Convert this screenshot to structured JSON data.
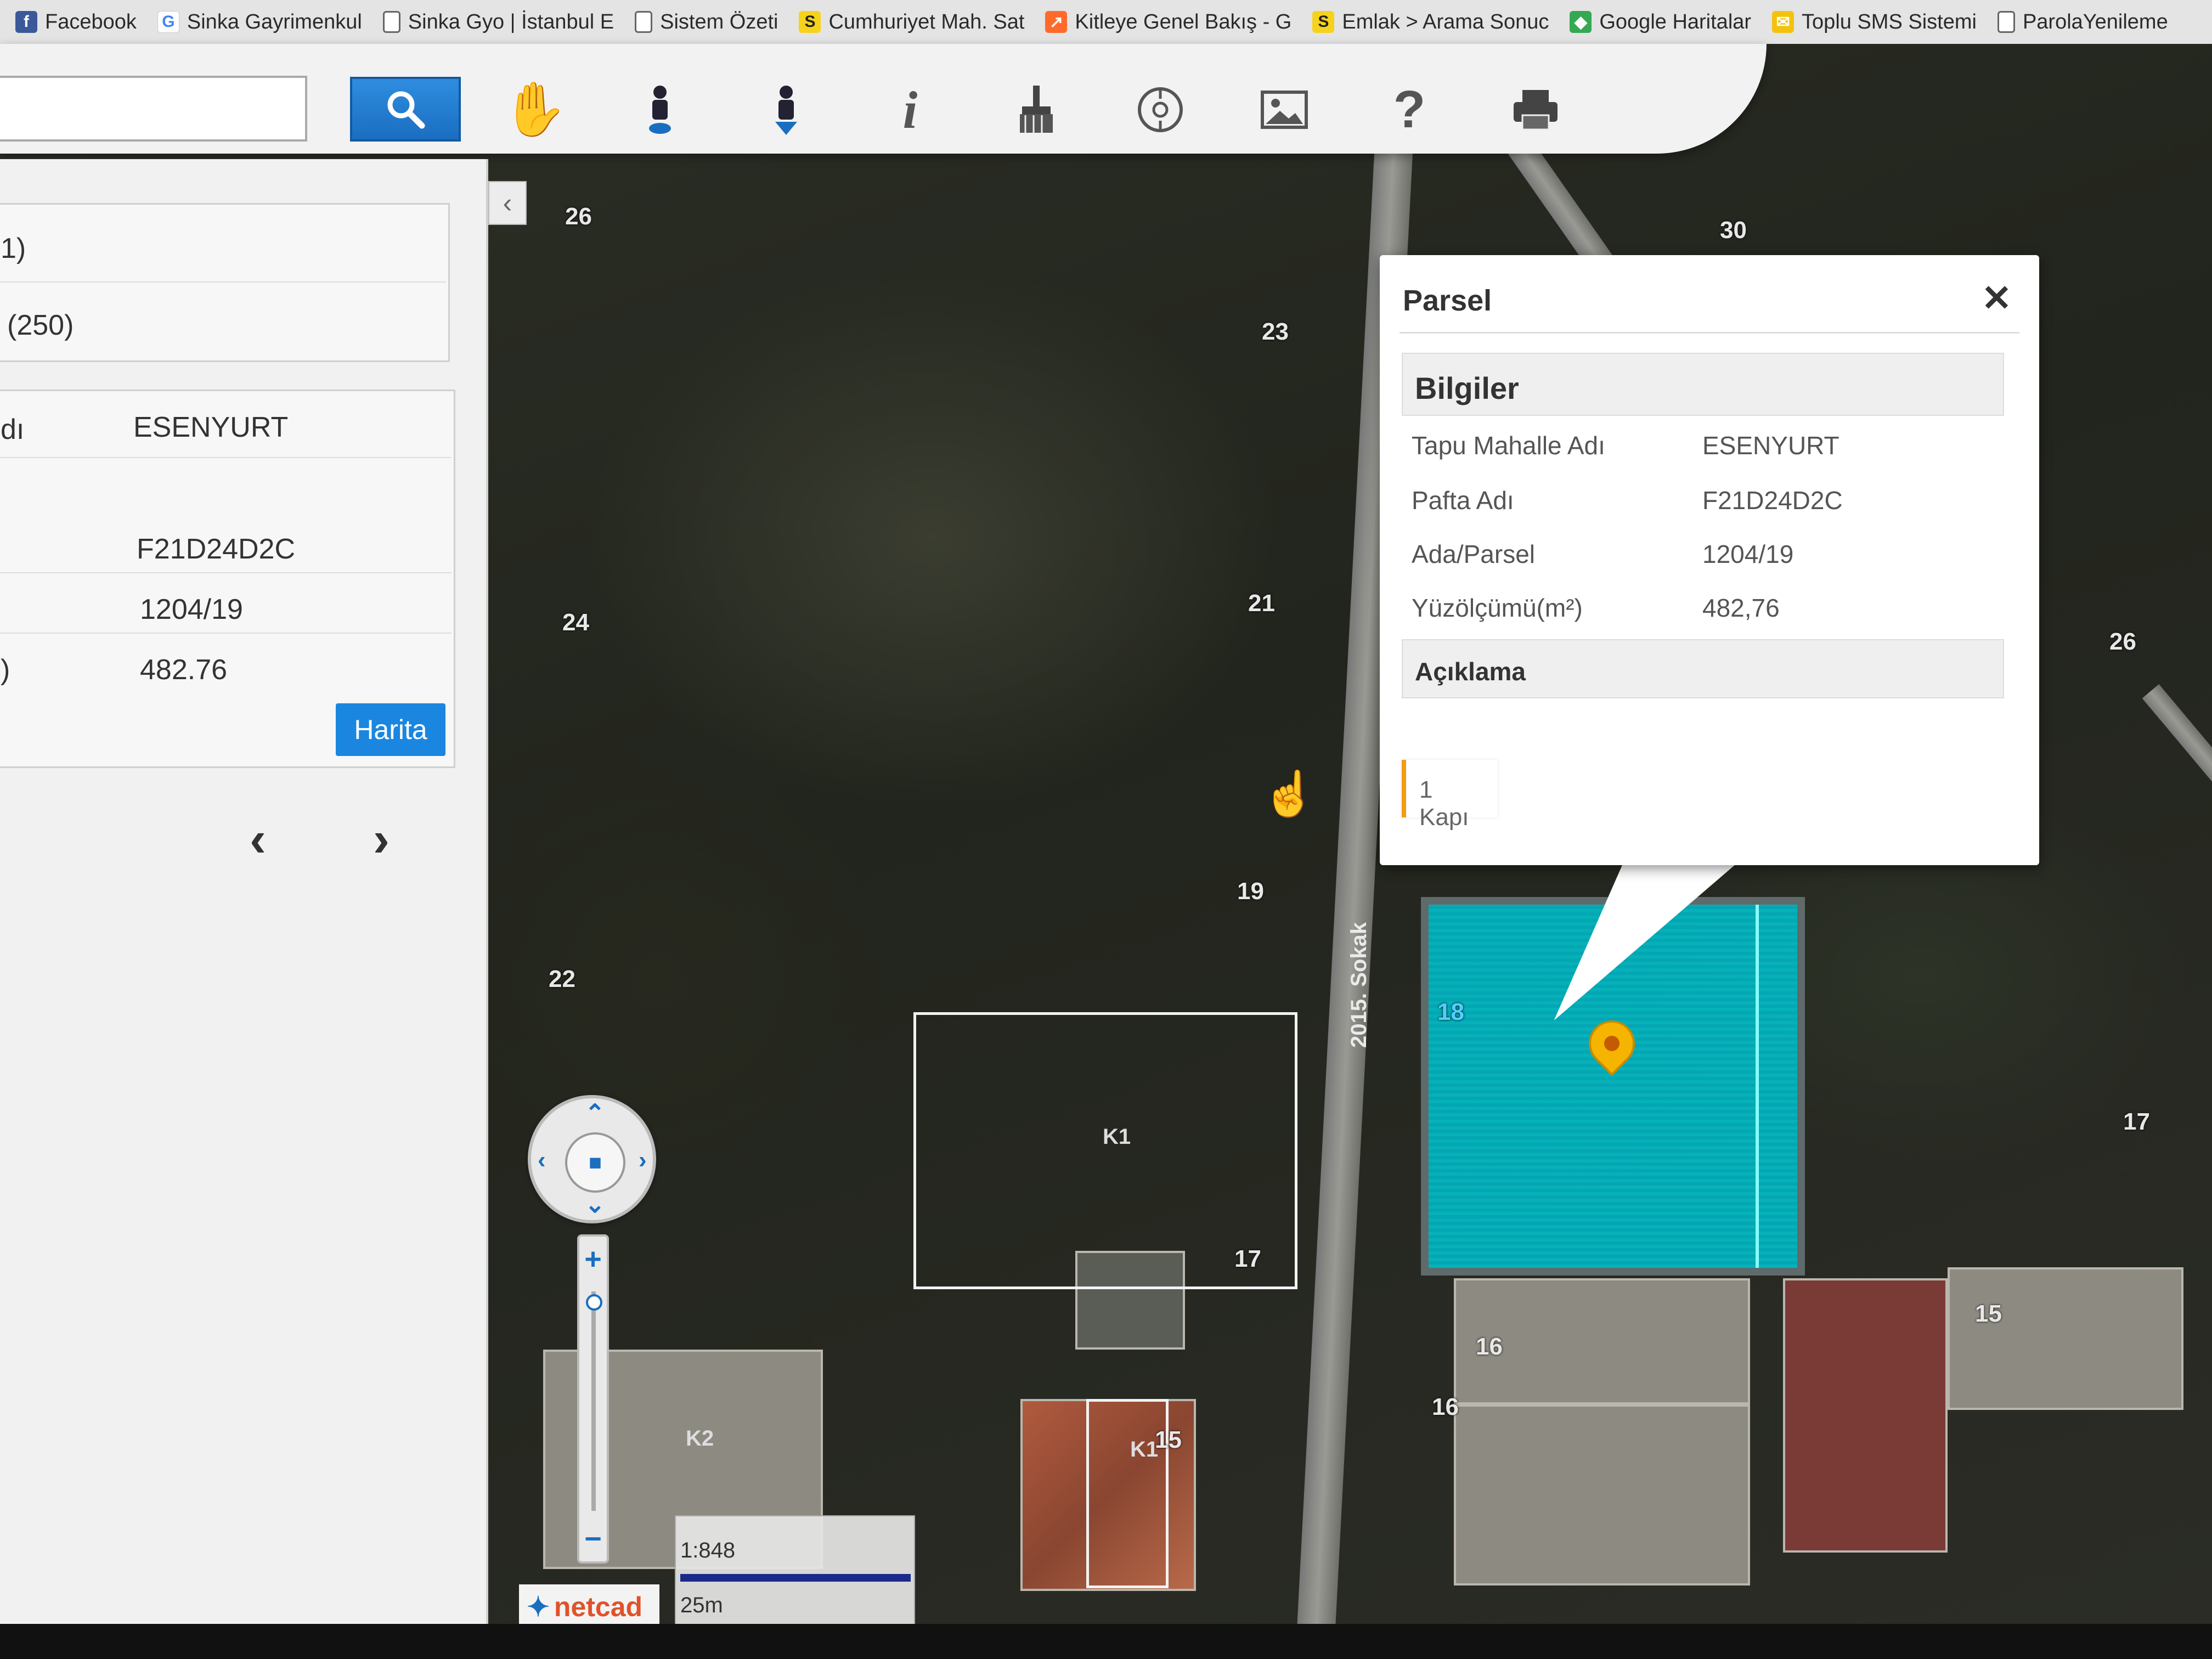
{
  "bookmarks": [
    {
      "label": "Facebook",
      "icon": "facebook-icon"
    },
    {
      "label": "Sinka Gayrimenkul",
      "icon": "google-icon"
    },
    {
      "label": "Sinka Gyo | İstanbul E",
      "icon": "document-icon"
    },
    {
      "label": "Sistem Özeti",
      "icon": "document-icon"
    },
    {
      "label": "Cumhuriyet Mah. Sat",
      "icon": "s-icon"
    },
    {
      "label": "Kitleye Genel Bakış - G",
      "icon": "chart-icon"
    },
    {
      "label": "Emlak > Arama Sonuc",
      "icon": "s-icon"
    },
    {
      "label": "Google Haritalar",
      "icon": "map-icon"
    },
    {
      "label": "Toplu SMS Sistemi",
      "icon": "mail-icon"
    },
    {
      "label": "ParolaYenileme",
      "icon": "document-icon"
    }
  ],
  "toolbar": {
    "search_value": "",
    "tools": [
      "hand-icon",
      "person-blue-icon",
      "person-blue-2-icon",
      "info-icon",
      "broom-icon",
      "compass-icon",
      "image-icon",
      "help-icon",
      "print-icon"
    ]
  },
  "left_panel": {
    "row1": "1)",
    "row2": "(250)",
    "field_label_1": "dı",
    "field_value_1": "ESENYURT",
    "field_value_2": "F21D24D2C",
    "field_value_3": "1204/19",
    "field_label_4": ")",
    "field_value_4": "482.76",
    "map_button": "Harita",
    "prev": "‹",
    "next": "›"
  },
  "popup": {
    "title": "Parsel",
    "close": "✕",
    "section_info": "Bilgiler",
    "rows": [
      {
        "label": "Tapu Mahalle Adı",
        "value": "ESENYURT"
      },
      {
        "label": "Pafta Adı",
        "value": "F21D24D2C"
      },
      {
        "label": "Ada/Parsel",
        "value": "1204/19"
      },
      {
        "label": "Yüzölçümü(m²)",
        "value": "482,76"
      }
    ],
    "section_desc": "Açıklama",
    "tab": "1 Kapı"
  },
  "map": {
    "street": "2015. Sokak",
    "numbers": [
      "26",
      "30",
      "23",
      "24",
      "21",
      "26",
      "19",
      "22",
      "17",
      "17",
      "16",
      "16",
      "15",
      "15",
      "18"
    ],
    "parcel_labels": [
      "K1",
      "K2",
      "K1"
    ]
  },
  "scale": {
    "ratio": "1:848",
    "distance": "25m"
  },
  "logo": "netcad",
  "colors": {
    "selected_parcel": "#00c8d2",
    "search_button": "#1a6ec0",
    "harita_button": "#1a86e0",
    "tab_accent": "#f39c12"
  }
}
